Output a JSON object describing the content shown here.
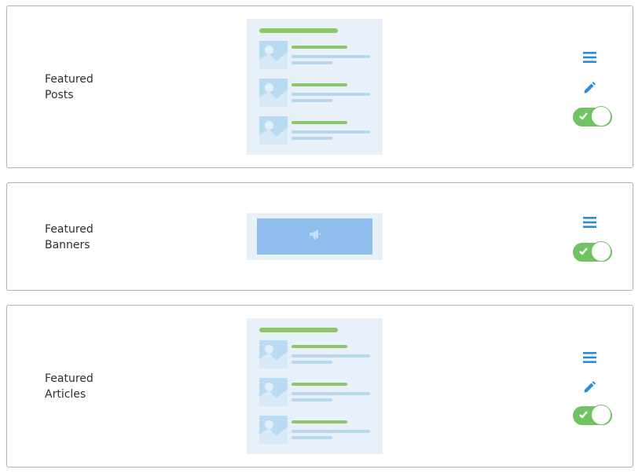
{
  "widgets": [
    {
      "title_line1": "Featured",
      "title_line2": "Posts",
      "enabled": true,
      "icons": [
        "menu-icon",
        "pencil-icon"
      ]
    },
    {
      "title_line1": "Featured",
      "title_line2": "Banners",
      "enabled": true,
      "icons": [
        "menu-icon"
      ]
    },
    {
      "title_line1": "Featured",
      "title_line2": "Articles",
      "enabled": true,
      "icons": [
        "menu-icon",
        "pencil-icon"
      ]
    }
  ],
  "colors": {
    "accent_green": "#70c361",
    "icon_blue": "#2a8bd6",
    "preview_bg": "#e8f1fa",
    "banner_blue": "#8fbded",
    "border": "#aab4c3"
  }
}
